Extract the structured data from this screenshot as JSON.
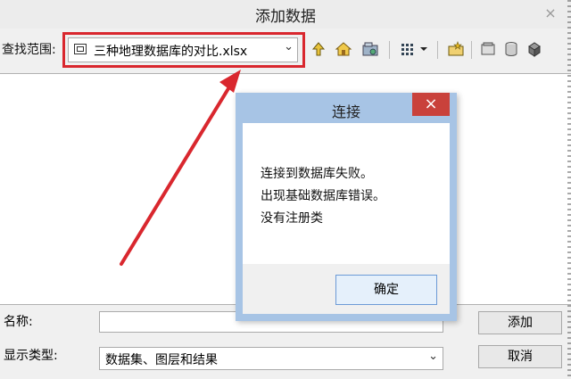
{
  "window": {
    "title": "添加数据",
    "close_glyph": "×"
  },
  "lookin": {
    "label": "查找范围:",
    "value": "三种地理数据库的对比.xlsx",
    "arrow_glyph": "⌄"
  },
  "form": {
    "name_label": "名称:",
    "name_value": "",
    "type_label": "显示类型:",
    "type_value": "数据集、图层和结果",
    "type_arrow_glyph": "⌄",
    "add_button": "添加",
    "cancel_button": "取消"
  },
  "dialog": {
    "title": "连接",
    "close_glyph": "×",
    "messages": [
      "连接到数据库失败。",
      "出现基础数据库错误。",
      "没有注册类"
    ],
    "ok_button": "确定"
  },
  "toolbar": {
    "icons": [
      "up-one-level-icon",
      "home-icon",
      "connect-folder-icon",
      "view-toggle-icon",
      "new-geodatabase-icon",
      "catalog-icon",
      "database-icon",
      "server-icon"
    ]
  },
  "colors": {
    "annotation_red": "#d9272e",
    "dialog_frame": "#a7c4e5",
    "dialog_close": "#c9413b"
  }
}
